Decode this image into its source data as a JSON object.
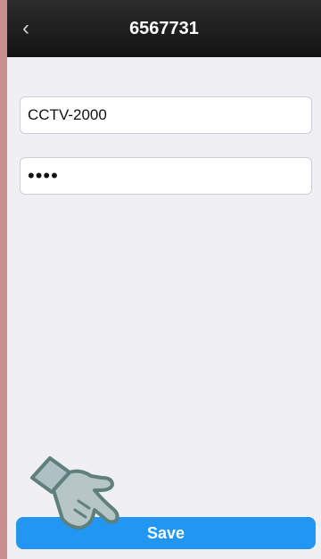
{
  "header": {
    "title": "6567731",
    "back_icon": "chevron-left-icon",
    "back_glyph": "‹"
  },
  "form": {
    "name_value": "CCTV-2000",
    "password_value": "••••"
  },
  "actions": {
    "save_label": "Save"
  },
  "overlay": {
    "pointer_icon": "pointing-hand-icon"
  },
  "colors": {
    "nav_bg": "#1c1c1c",
    "accent": "#2196f3",
    "page_bg": "#efeff4",
    "left_bar": "#c98f8f"
  }
}
